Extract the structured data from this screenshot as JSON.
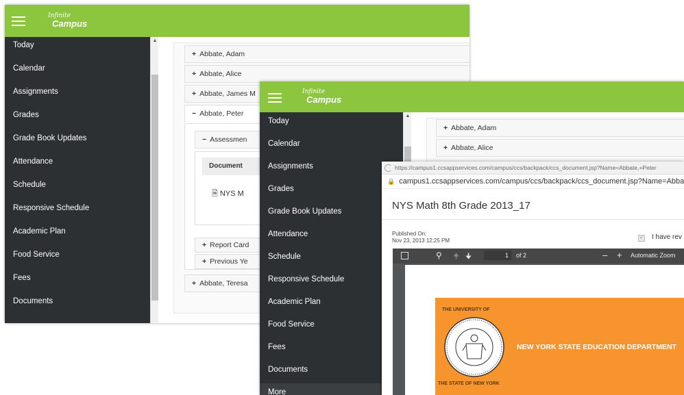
{
  "brand": {
    "logo_line1": "Infinite",
    "logo_line2": "Campus",
    "color_green": "#8cc63f",
    "color_sidebar": "#2d3033",
    "color_orange": "#f7942d"
  },
  "back_window": {
    "sidebar": [
      "Today",
      "Calendar",
      "Assignments",
      "Grades",
      "Grade Book Updates",
      "Attendance",
      "Schedule",
      "Responsive Schedule",
      "Academic Plan",
      "Food Service",
      "Fees",
      "Documents"
    ],
    "students": [
      {
        "sign": "+",
        "name": "Abbate, Adam"
      },
      {
        "sign": "+",
        "name": "Abbate, Alice"
      },
      {
        "sign": "+",
        "name": "Abbate, James M"
      },
      {
        "sign": "−",
        "name": "Abbate, Peter"
      }
    ],
    "assessment": {
      "sign": "−",
      "label": "Assessmen"
    },
    "doc_header": "Document",
    "doc_link": "NYS M",
    "sub_sections": [
      {
        "sign": "+",
        "label": "Report Card"
      },
      {
        "sign": "+",
        "label": "Previous Ye"
      }
    ],
    "last_student": {
      "sign": "+",
      "name": "Abbate, Teresa"
    }
  },
  "front_window": {
    "sidebar": [
      "Today",
      "Calendar",
      "Assignments",
      "Grades",
      "Grade Book Updates",
      "Attendance",
      "Schedule",
      "Responsive Schedule",
      "Academic Plan",
      "Food Service",
      "Fees",
      "Documents",
      "More"
    ],
    "students": [
      {
        "sign": "+",
        "name": "Abbate, Adam"
      },
      {
        "sign": "+",
        "name": "Abbate, Alice"
      }
    ]
  },
  "pdf_window": {
    "title_url": "https://campus1.ccsappservices.com/campus/ccs/backpack/ccs_document.jsp?Name=Abbate,+Peter",
    "address_url": "campus1.ccsappservices.com/campus/ccs/backpack/ccs_document.jsp?Name=Abbat",
    "doc_title": "NYS Math 8th Grade 2013_17",
    "published_label": "Published On:",
    "published_date": "Nov 23, 2013 12:25 PM",
    "review_label": "I have rev",
    "page_current": "1",
    "page_of": "of 2",
    "zoom": "Automatic Zoom",
    "banner_text": "NEW YORK STATE EDUCATION DEPARTMENT",
    "seal_top": "THE UNIVERSITY OF",
    "seal_bottom": "THE STATE OF NEW YORK"
  }
}
